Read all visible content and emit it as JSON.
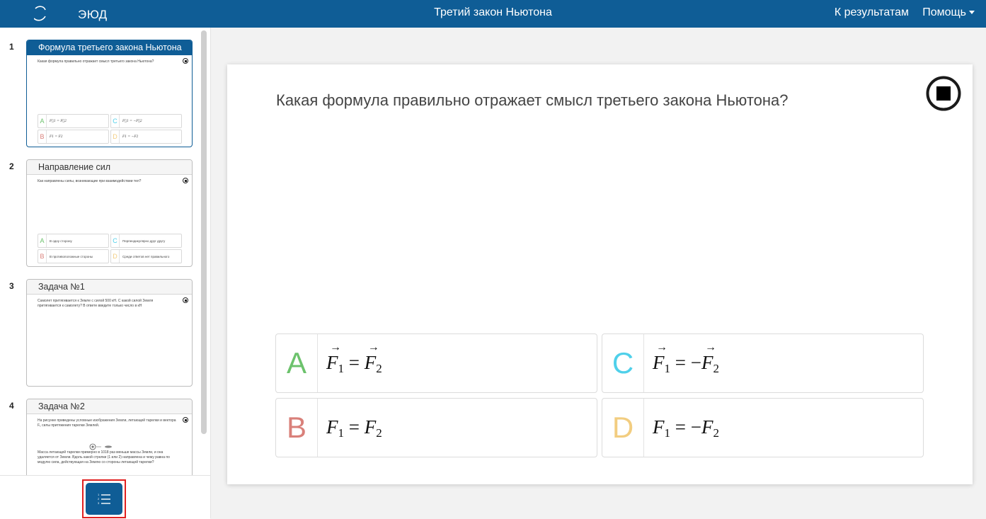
{
  "header": {
    "logo_text": "ЭЮД",
    "title": "Третий закон Ньютона",
    "results_link": "К результатам",
    "help_menu": "Помощь"
  },
  "sidebar": {
    "slides": [
      {
        "number": "1",
        "title": "Формула третьего закона Ньютона",
        "question": "Какая формула правильно отражает смысл третьего закона Ньютона?",
        "options": [
          {
            "letter": "A",
            "text": "F⃗1 = F⃗2"
          },
          {
            "letter": "C",
            "text": "F⃗1 = −F⃗2"
          },
          {
            "letter": "B",
            "text": "F1 = F2"
          },
          {
            "letter": "D",
            "text": "F1 = −F2"
          }
        ]
      },
      {
        "number": "2",
        "title": "Направление сил",
        "question": "Как направлены силы, возникающие при взаимодействии тел?",
        "options": [
          {
            "letter": "A",
            "text": "В одну сторону"
          },
          {
            "letter": "C",
            "text": "Перпендикулярно друг другу"
          },
          {
            "letter": "B",
            "text": "В противоположные стороны"
          },
          {
            "letter": "D",
            "text": "Среди ответов нет правильного"
          }
        ]
      },
      {
        "number": "3",
        "title": "Задача №1",
        "question": "Самолет притягивается к Земле с силой 500 кН. С какой силой Земля притягивается к самолету? В ответе введите только число в кН"
      },
      {
        "number": "4",
        "title": "Задача №2",
        "question": "На рисунке приведены условные изображения Земли, летающей тарелки и вектора F₁ силы притяжения тарелки Землей.",
        "question2": "Масса летающей тарелки примерно в 1018 раз меньше массы Земли, и она удаляется от Земли. Вдоль какой стрелки (1 или 2) направлена и чему равна по модулю сила, действующая на Землю со стороны летающей тарелки?"
      }
    ]
  },
  "main": {
    "question": "Какая формула правильно отражает смысл третьего закона Ньютона?",
    "options": [
      {
        "letter": "A",
        "color": "#6cc26c",
        "vector": true,
        "negative": false
      },
      {
        "letter": "C",
        "color": "#4fd0ea",
        "vector": true,
        "negative": true
      },
      {
        "letter": "B",
        "color": "#d9807a",
        "vector": false,
        "negative": false
      },
      {
        "letter": "D",
        "color": "#f2cd80",
        "vector": false,
        "negative": true
      }
    ],
    "formula": {
      "symbol": "F",
      "sub1": "1",
      "sub2": "2",
      "equals": "=",
      "minus": "−"
    }
  },
  "colors": {
    "brand": "#0f5d96",
    "highlight_border": "#e02020"
  },
  "icons": {
    "stop": "stop-icon",
    "list": "numbered-list-icon"
  }
}
